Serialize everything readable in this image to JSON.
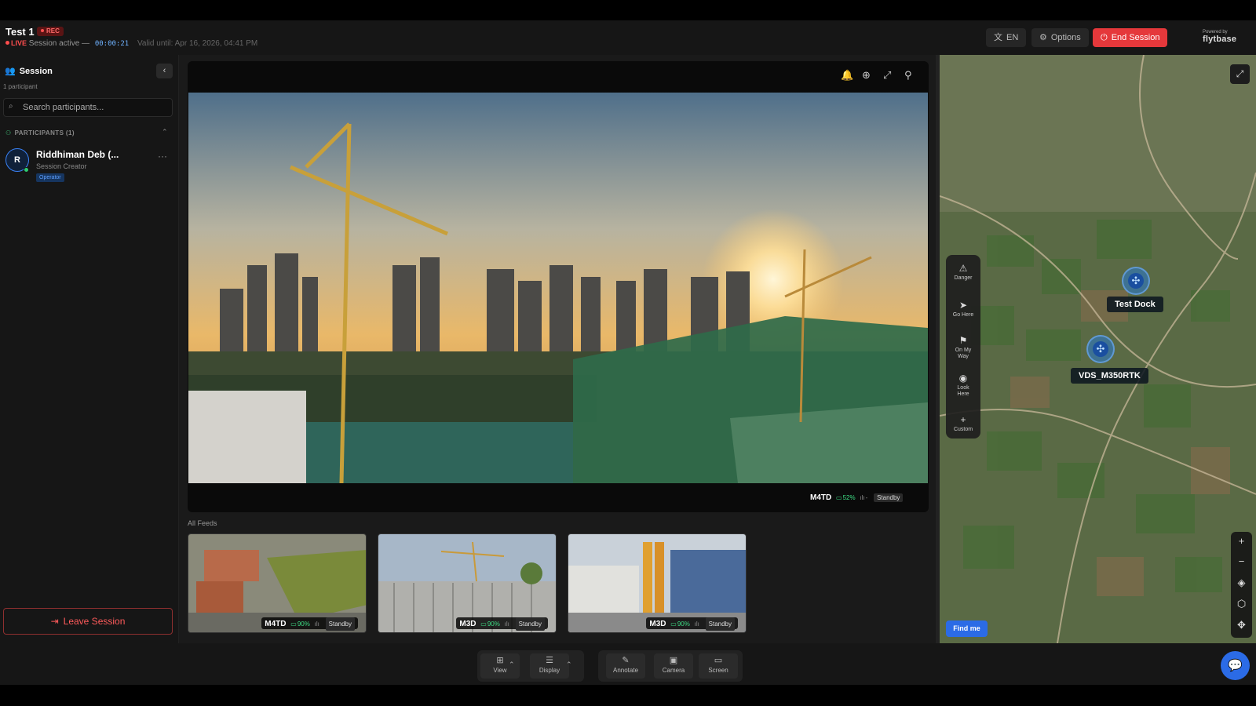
{
  "header": {
    "title": "Test 1",
    "rec_badge": "REC",
    "live_label": "LIVE",
    "session_status": "Session active —",
    "timer": "00:00:21",
    "valid_until": "Valid until: Apr 16, 2026, 04:41 PM",
    "language_label": "EN",
    "options_label": "Options",
    "end_session_label": "End Session",
    "powered_by": "Powered by",
    "brand": "flytbase"
  },
  "sidebar": {
    "title": "Session",
    "participant_count": "1 participant",
    "search_placeholder": "Search participants...",
    "participants_header": "PARTICIPANTS (1)",
    "participants": [
      {
        "initial": "R",
        "name": "Riddhiman Deb (...",
        "role": "Session Creator",
        "badge": "Operator"
      }
    ],
    "leave_label": "Leave Session"
  },
  "main_feed": {
    "drone": "M4TD",
    "battery": "52%",
    "signal": "-",
    "state": "Standby"
  },
  "all_feeds_label": "All Feeds",
  "feeds": [
    {
      "drone": "M4TD",
      "battery": "90%",
      "state": "Standby"
    },
    {
      "drone": "M3D",
      "battery": "90%",
      "state": "Standby"
    },
    {
      "drone": "M3D",
      "battery": "90%",
      "state": "Standby"
    }
  ],
  "toolbar": {
    "view_label": "View",
    "display_label": "Display",
    "annotate_label": "Annotate",
    "camera_label": "Camera",
    "screen_label": "Screen"
  },
  "map": {
    "tools": {
      "danger": "Danger",
      "go_here": "Go Here",
      "on_my_way": "On My Way",
      "look_here": "Look Here",
      "custom": "Custom"
    },
    "markers": {
      "dock": "Test Dock",
      "drone": "VDS_M350RTK"
    },
    "find_me_label": "Find me"
  },
  "colors": {
    "accent_blue": "#2b6be6",
    "danger_red": "#e5383b",
    "live_red": "#ff4d4d",
    "battery_green": "#3ddc84"
  }
}
